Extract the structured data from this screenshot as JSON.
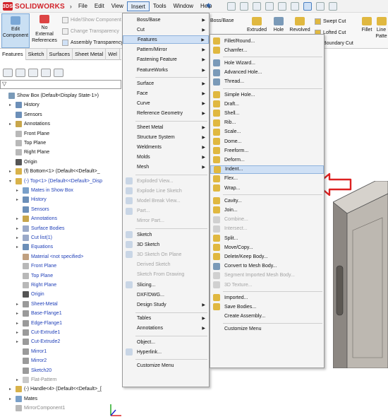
{
  "app": {
    "name": "SOLIDWORKS"
  },
  "menubar": [
    "File",
    "Edit",
    "View",
    "Insert",
    "Tools",
    "Window",
    "Help"
  ],
  "command_manager": {
    "edit_component": "Edit\nComponent",
    "no_external": "No\nExternal\nReferences",
    "hide_show": "Hide/Show Component",
    "change_transparency": "Change Transparency",
    "assembly_transparency": "Assembly Transparency",
    "boss_base": "Boss/Base",
    "extruded": "Extruded",
    "hole": "Hole",
    "revolved": "Revolved",
    "swept_cut": "Swept Cut",
    "lofted_cut": "Lofted Cut",
    "boundary_cut": "Boundary Cut",
    "fillet": "Fillet",
    "linear_pattern": "Line\nPatte"
  },
  "tabs": [
    "Features",
    "Sketch",
    "Surfaces",
    "Sheet Metal",
    "Wel"
  ],
  "tree": [
    {
      "label": "Show Box  (Default<Display State-1>)",
      "level": 0,
      "exp": "",
      "color": "#7a9ab8",
      "style": ""
    },
    {
      "label": "History",
      "level": 1,
      "exp": "▸",
      "color": "#6c8fb8",
      "style": ""
    },
    {
      "label": "Sensors",
      "level": 1,
      "exp": "",
      "color": "#6c8fb8",
      "style": ""
    },
    {
      "label": "Annotations",
      "level": 1,
      "exp": "▸",
      "color": "#c8a64b",
      "style": ""
    },
    {
      "label": "Front Plane",
      "level": 1,
      "exp": "",
      "color": "#b8b8b8",
      "style": ""
    },
    {
      "label": "Top Plane",
      "level": 1,
      "exp": "",
      "color": "#b8b8b8",
      "style": ""
    },
    {
      "label": "Right Plane",
      "level": 1,
      "exp": "",
      "color": "#b8b8b8",
      "style": ""
    },
    {
      "label": "Origin",
      "level": 1,
      "exp": "",
      "color": "#555",
      "style": ""
    },
    {
      "label": "(f) Bottom<1> (Default<<Default>_",
      "level": 1,
      "exp": "▸",
      "color": "#d8b24a",
      "style": ""
    },
    {
      "label": "(-) Top<1> (Default<<Default>_Disp",
      "level": 1,
      "exp": "▾",
      "color": "#d8b24a",
      "style": "blue"
    },
    {
      "label": "Mates in Show Box",
      "level": 2,
      "exp": "▸",
      "color": "#7aa0c9",
      "style": "blue"
    },
    {
      "label": "History",
      "level": 2,
      "exp": "▸",
      "color": "#6c8fb8",
      "style": "blue"
    },
    {
      "label": "Sensors",
      "level": 2,
      "exp": "",
      "color": "#6c8fb8",
      "style": "blue"
    },
    {
      "label": "Annotations",
      "level": 2,
      "exp": "▸",
      "color": "#c8a64b",
      "style": "blue"
    },
    {
      "label": "Surface Bodies",
      "level": 2,
      "exp": "▸",
      "color": "#9aa9c8",
      "style": "blue"
    },
    {
      "label": "Cut list(1)",
      "level": 2,
      "exp": "▸",
      "color": "#9aa9c8",
      "style": "blue"
    },
    {
      "label": "Equations",
      "level": 2,
      "exp": "▸",
      "color": "#6c8fb8",
      "style": "blue"
    },
    {
      "label": "Material <not specified>",
      "level": 2,
      "exp": "",
      "color": "#c0a080",
      "style": "blue"
    },
    {
      "label": "Front Plane",
      "level": 2,
      "exp": "",
      "color": "#b8b8b8",
      "style": "blue"
    },
    {
      "label": "Top Plane",
      "level": 2,
      "exp": "",
      "color": "#b8b8b8",
      "style": "blue"
    },
    {
      "label": "Right Plane",
      "level": 2,
      "exp": "",
      "color": "#b8b8b8",
      "style": "blue"
    },
    {
      "label": "Origin",
      "level": 2,
      "exp": "",
      "color": "#555",
      "style": "blue"
    },
    {
      "label": "Sheet-Metal",
      "level": 2,
      "exp": "▸",
      "color": "#9a9a9a",
      "style": "blue"
    },
    {
      "label": "Base-Flange1",
      "level": 2,
      "exp": "▸",
      "color": "#9a9a9a",
      "style": "blue"
    },
    {
      "label": "Edge-Flange1",
      "level": 2,
      "exp": "▸",
      "color": "#9a9a9a",
      "style": "blue"
    },
    {
      "label": "Cut-Extrude1",
      "level": 2,
      "exp": "▸",
      "color": "#9a9a9a",
      "style": "blue"
    },
    {
      "label": "Cut-Extrude2",
      "level": 2,
      "exp": "▸",
      "color": "#9a9a9a",
      "style": "blue"
    },
    {
      "label": "Mirror1",
      "level": 2,
      "exp": "",
      "color": "#9a9a9a",
      "style": "blue"
    },
    {
      "label": "Mirror2",
      "level": 2,
      "exp": "",
      "color": "#9a9a9a",
      "style": "blue"
    },
    {
      "label": "Sketch20",
      "level": 2,
      "exp": "",
      "color": "#9a9a9a",
      "style": "blue"
    },
    {
      "label": "Flat-Pattern",
      "level": 2,
      "exp": "▸",
      "color": "#c8c8c8",
      "style": "gray"
    },
    {
      "label": "(-) Handle<4> (Default<<Default>_[",
      "level": 1,
      "exp": "▸",
      "color": "#d8b24a",
      "style": ""
    },
    {
      "label": "Mates",
      "level": 1,
      "exp": "▸",
      "color": "#7aa0c9",
      "style": ""
    },
    {
      "label": "MirrorComponent1",
      "level": 1,
      "exp": "",
      "color": "#b8b8b8",
      "style": "gray"
    }
  ],
  "insert_menu": [
    {
      "label": "Boss/Base",
      "sub": true
    },
    {
      "label": "Cut",
      "sub": true
    },
    {
      "label": "Features",
      "sub": true,
      "hl": true
    },
    {
      "label": "Pattern/Mirror",
      "sub": true
    },
    {
      "label": "Fastening Feature",
      "sub": true
    },
    {
      "label": "FeatureWorks",
      "sub": true
    },
    {
      "sep": true
    },
    {
      "label": "Surface",
      "sub": true
    },
    {
      "label": "Face",
      "sub": true
    },
    {
      "label": "Curve",
      "sub": true
    },
    {
      "label": "Reference Geometry",
      "sub": true
    },
    {
      "sep": true
    },
    {
      "label": "Sheet Metal",
      "sub": true
    },
    {
      "label": "Structure System",
      "sub": true
    },
    {
      "label": "Weldments",
      "sub": true
    },
    {
      "label": "Molds",
      "sub": true
    },
    {
      "label": "Mesh",
      "sub": true
    },
    {
      "sep": true
    },
    {
      "label": "Exploded View...",
      "dis": true,
      "icon": true
    },
    {
      "label": "Explode Line Sketch",
      "dis": true,
      "icon": true
    },
    {
      "label": "Model Break View...",
      "dis": true,
      "icon": true
    },
    {
      "label": "Part...",
      "dis": true,
      "icon": true
    },
    {
      "label": "Mirror Part...",
      "dis": true
    },
    {
      "sep": true
    },
    {
      "label": "Sketch",
      "icon": true
    },
    {
      "label": "3D Sketch",
      "icon": true
    },
    {
      "label": "3D Sketch On Plane",
      "dis": true,
      "icon": true
    },
    {
      "label": "Derived Sketch",
      "dis": true
    },
    {
      "label": "Sketch From Drawing",
      "dis": true
    },
    {
      "label": "Slicing...",
      "icon": true
    },
    {
      "label": "DXF/DWG..."
    },
    {
      "label": "Design Study",
      "sub": true
    },
    {
      "sep": true
    },
    {
      "label": "Tables",
      "sub": true
    },
    {
      "label": "Annotations",
      "sub": true
    },
    {
      "sep": true
    },
    {
      "label": "Object..."
    },
    {
      "label": "Hyperlink...",
      "icon": true
    },
    {
      "sep": true
    },
    {
      "label": "Customize Menu"
    }
  ],
  "features_menu": [
    {
      "label": "Fillet/Round...",
      "icon": "#e0b840"
    },
    {
      "label": "Chamfer...",
      "icon": "#e0b840"
    },
    {
      "sep": true
    },
    {
      "label": "Hole Wizard...",
      "icon": "#7a9ab8"
    },
    {
      "label": "Advanced Hole...",
      "icon": "#7a9ab8"
    },
    {
      "label": "Thread...",
      "icon": "#7a9ab8"
    },
    {
      "sep": true
    },
    {
      "label": "Simple Hole...",
      "icon": "#e0b840"
    },
    {
      "label": "Draft...",
      "icon": "#e0b840"
    },
    {
      "label": "Shell...",
      "icon": "#e0b840"
    },
    {
      "label": "Rib...",
      "icon": "#e0b840"
    },
    {
      "label": "Scale...",
      "icon": "#e0b840"
    },
    {
      "label": "Dome...",
      "icon": "#e0b840"
    },
    {
      "label": "Freeform...",
      "icon": "#e0b840"
    },
    {
      "label": "Deform...",
      "icon": "#e0b840"
    },
    {
      "label": "Indent...",
      "icon": "#e0b840",
      "hl": true
    },
    {
      "label": "Flex...",
      "icon": "#e0b840"
    },
    {
      "label": "Wrap...",
      "icon": "#e0b840"
    },
    {
      "sep": true
    },
    {
      "label": "Cavity...",
      "icon": "#e0b840"
    },
    {
      "label": "Join...",
      "icon": "#e0b840"
    },
    {
      "label": "Combine...",
      "dis": true,
      "icon": "#d0d0d0"
    },
    {
      "label": "Intersect...",
      "dis": true,
      "icon": "#d0d0d0"
    },
    {
      "label": "Split...",
      "icon": "#e0b840"
    },
    {
      "label": "Move/Copy...",
      "icon": "#e0b840"
    },
    {
      "label": "Delete/Keep Body...",
      "icon": "#e0b840"
    },
    {
      "label": "Convert to Mesh Body...",
      "icon": "#7a9ab8"
    },
    {
      "label": "Segment Imported Mesh Body...",
      "dis": true,
      "icon": "#d0d0d0"
    },
    {
      "label": "3D Texture...",
      "dis": true,
      "icon": "#d0d0d0"
    },
    {
      "sep": true
    },
    {
      "label": "Imported...",
      "icon": "#e0b840"
    },
    {
      "label": "Save Bodies...",
      "icon": "#e0b840"
    },
    {
      "label": "Create Assembly..."
    },
    {
      "sep": true
    },
    {
      "label": "Customize Menu"
    }
  ]
}
